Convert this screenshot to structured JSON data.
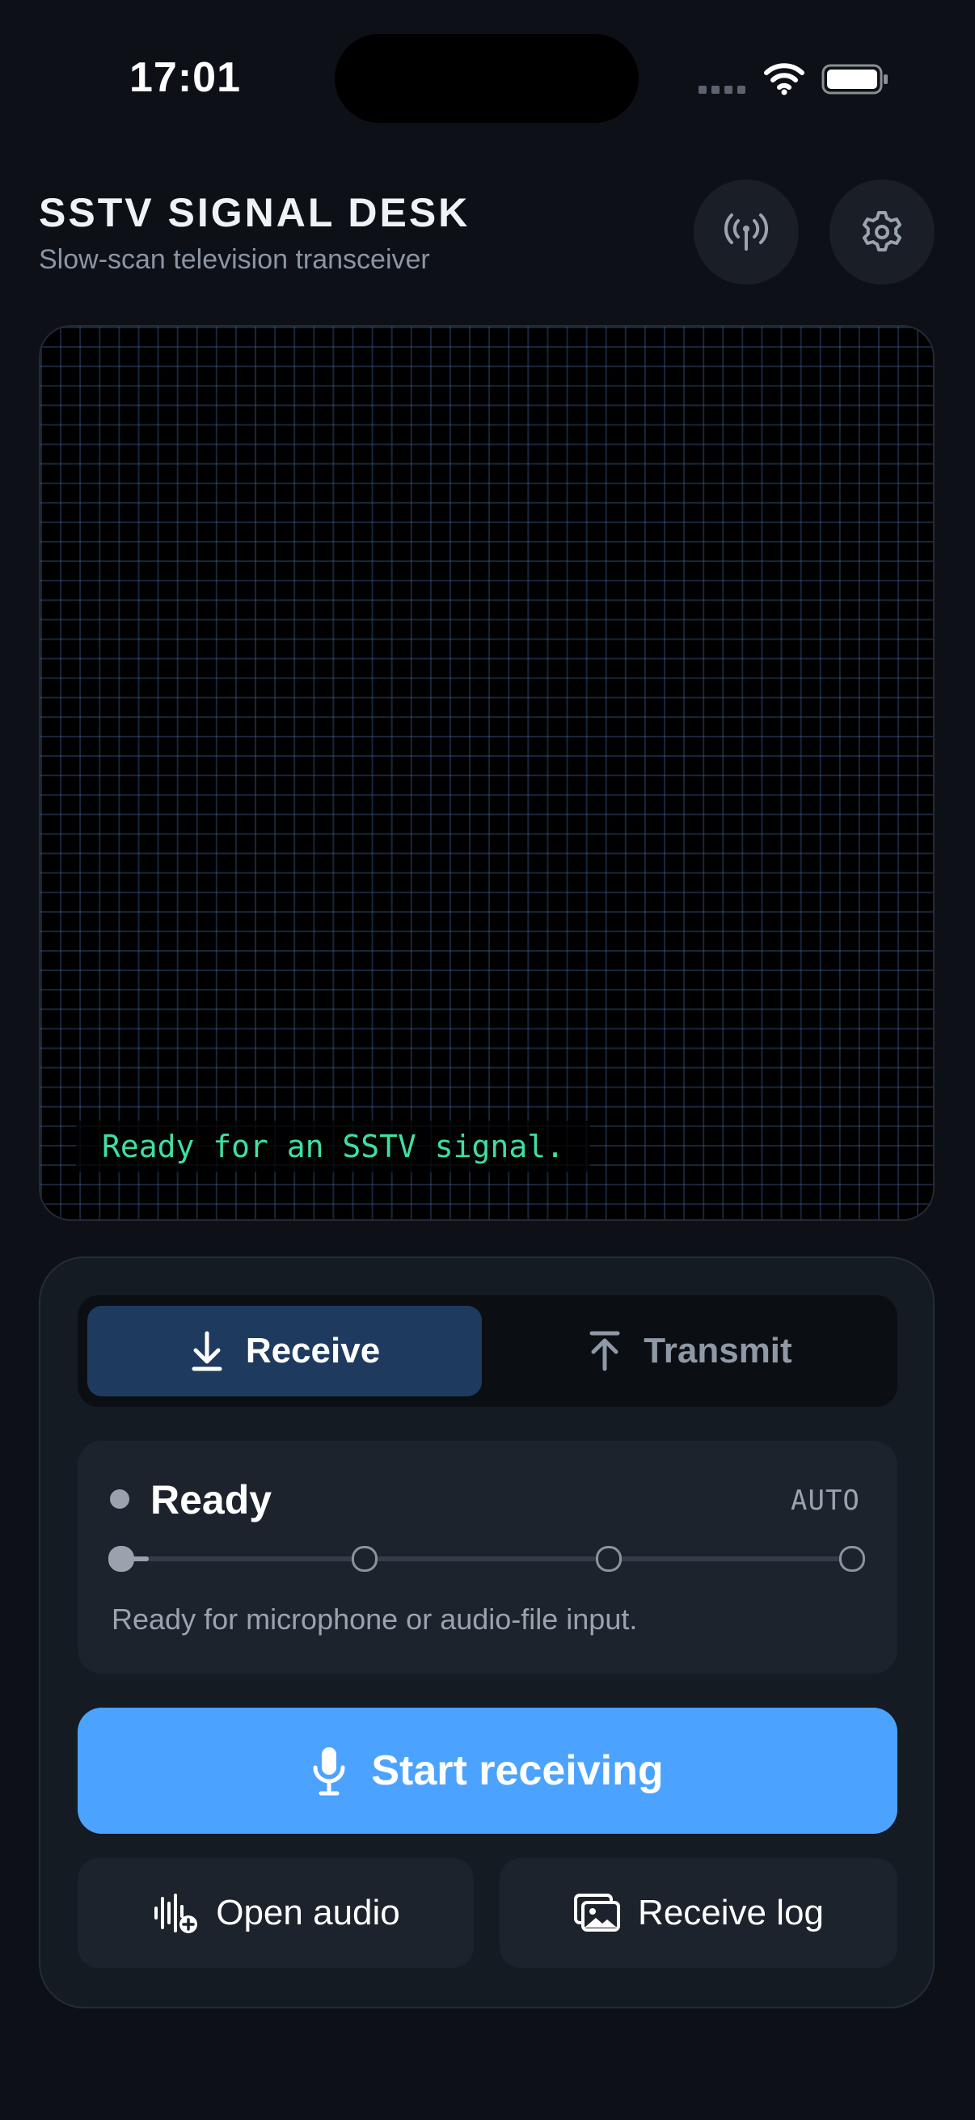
{
  "status_bar": {
    "time": "17:01"
  },
  "header": {
    "title": "SSTV SIGNAL DESK",
    "subtitle": "Slow-scan television transceiver",
    "antenna_icon": "antenna-icon",
    "settings_icon": "gear-icon"
  },
  "display": {
    "status_text": "Ready for an SSTV signal."
  },
  "mode_switch": {
    "receive_label": "Receive",
    "transmit_label": "Transmit",
    "selected": "Receive"
  },
  "status": {
    "title": "Ready",
    "mode": "AUTO",
    "description": "Ready for microphone or audio-file input.",
    "steps_total": 4,
    "steps_active": 1
  },
  "actions": {
    "primary_label": "Start receiving",
    "open_audio_label": "Open audio",
    "receive_log_label": "Receive log"
  },
  "colors": {
    "background": "#0d1117",
    "accent": "#4ca3ff",
    "selected_tab": "#1f3a5f",
    "terminal_text": "#3ee0a0"
  }
}
